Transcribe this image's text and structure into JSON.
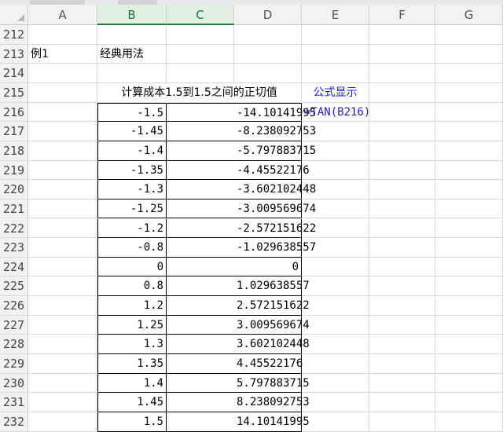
{
  "columns": [
    "A",
    "B",
    "C",
    "D",
    "E",
    "F",
    "G"
  ],
  "rows": [
    {
      "num": "212",
      "A": "",
      "B": "",
      "C": "",
      "D": "",
      "E": ""
    },
    {
      "num": "213",
      "A": "例1",
      "B": "经典用法",
      "C": "",
      "D": "",
      "E": ""
    },
    {
      "num": "214",
      "A": "",
      "B": "",
      "C": "",
      "D": "",
      "E": ""
    },
    {
      "num": "215",
      "A": "",
      "B": "",
      "C": "",
      "D": "",
      "E": "公式显示"
    },
    {
      "num": "216",
      "A": "",
      "B": "-1.5",
      "C": "",
      "D": "-14.10141995",
      "E": "=TAN(B216)"
    },
    {
      "num": "217",
      "A": "",
      "B": "-1.45",
      "C": "",
      "D": "-8.238092753",
      "E": ""
    },
    {
      "num": "218",
      "A": "",
      "B": "-1.4",
      "C": "",
      "D": "-5.797883715",
      "E": ""
    },
    {
      "num": "219",
      "A": "",
      "B": "-1.35",
      "C": "",
      "D": "-4.45522176",
      "E": ""
    },
    {
      "num": "220",
      "A": "",
      "B": "-1.3",
      "C": "",
      "D": "-3.602102448",
      "E": ""
    },
    {
      "num": "221",
      "A": "",
      "B": "-1.25",
      "C": "",
      "D": "-3.009569674",
      "E": ""
    },
    {
      "num": "222",
      "A": "",
      "B": "-1.2",
      "C": "",
      "D": "-2.572151622",
      "E": ""
    },
    {
      "num": "223",
      "A": "",
      "B": "-0.8",
      "C": "",
      "D": "-1.029638557",
      "E": ""
    },
    {
      "num": "224",
      "A": "",
      "B": "0",
      "C": "",
      "D": "0",
      "E": ""
    },
    {
      "num": "225",
      "A": "",
      "B": "0.8",
      "C": "",
      "D": "1.029638557",
      "E": ""
    },
    {
      "num": "226",
      "A": "",
      "B": "1.2",
      "C": "",
      "D": "2.572151622",
      "E": ""
    },
    {
      "num": "227",
      "A": "",
      "B": "1.25",
      "C": "",
      "D": "3.009569674",
      "E": ""
    },
    {
      "num": "228",
      "A": "",
      "B": "1.3",
      "C": "",
      "D": "3.602102448",
      "E": ""
    },
    {
      "num": "229",
      "A": "",
      "B": "1.35",
      "C": "",
      "D": "4.45522176",
      "E": ""
    },
    {
      "num": "230",
      "A": "",
      "B": "1.4",
      "C": "",
      "D": "5.797883715",
      "E": ""
    },
    {
      "num": "231",
      "A": "",
      "B": "1.45",
      "C": "",
      "D": "8.238092753",
      "E": ""
    },
    {
      "num": "232",
      "A": "",
      "B": "1.5",
      "C": "",
      "D": "14.10141995",
      "E": ""
    }
  ],
  "merged_title": "计算成本1.5到1.5之间的正切值",
  "selected_columns": [
    "B",
    "C"
  ],
  "colors": {
    "formula_text": "#1f1fcc",
    "selected_header": "#217346"
  }
}
